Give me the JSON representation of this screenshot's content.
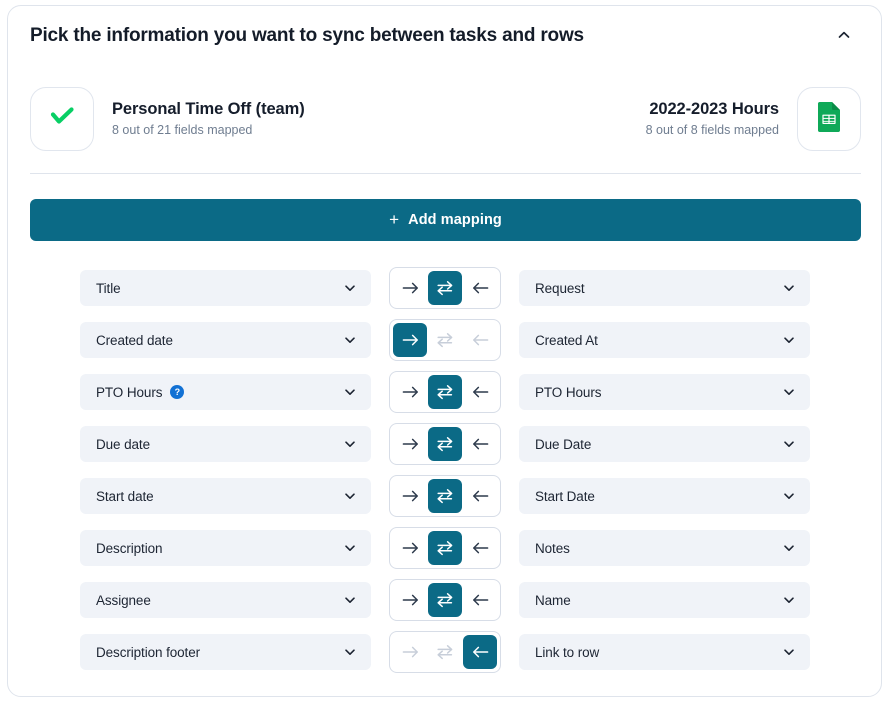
{
  "header": {
    "title": "Pick the information you want to sync between tasks and rows",
    "collapse_icon": "chevron-up-icon"
  },
  "summary": {
    "left": {
      "icon": "wrike-checkmark-icon",
      "name": "Personal Time Off (team)",
      "fields_mapped": "8 out of 21 fields mapped"
    },
    "right": {
      "icon": "google-sheets-icon",
      "name": "2022-2023 Hours",
      "fields_mapped": "8 out of 8 fields mapped"
    }
  },
  "toolbar": {
    "add_mapping_label": "Add mapping",
    "add_mapping_plus": "+"
  },
  "colors": {
    "accent_teal": "#0b6a86",
    "field_background": "#f0f3f8",
    "help_badge_blue": "#1271d4",
    "wrike_green": "#08cf65",
    "sheets_green": "#0fa958",
    "muted_text": "#6f7d90",
    "border": "#dfe4ec",
    "disabled_arrow": "#c7ced9"
  },
  "mappings": [
    {
      "left_field": "Title",
      "right_field": "Request",
      "direction": "both",
      "has_help": false,
      "right_arrow_state": "enabled",
      "both_arrow_state": "active",
      "left_arrow_state": "enabled"
    },
    {
      "left_field": "Created date",
      "right_field": "Created At",
      "direction": "right",
      "has_help": false,
      "right_arrow_state": "active",
      "both_arrow_state": "disabled",
      "left_arrow_state": "disabled"
    },
    {
      "left_field": "PTO Hours",
      "right_field": "PTO Hours",
      "direction": "both",
      "has_help": true,
      "help_label": "?",
      "right_arrow_state": "enabled",
      "both_arrow_state": "active",
      "left_arrow_state": "enabled"
    },
    {
      "left_field": "Due date",
      "right_field": "Due Date",
      "direction": "both",
      "has_help": false,
      "right_arrow_state": "enabled",
      "both_arrow_state": "active",
      "left_arrow_state": "enabled"
    },
    {
      "left_field": "Start date",
      "right_field": "Start Date",
      "direction": "both",
      "has_help": false,
      "right_arrow_state": "enabled",
      "both_arrow_state": "active",
      "left_arrow_state": "enabled"
    },
    {
      "left_field": "Description",
      "right_field": "Notes",
      "direction": "both",
      "has_help": false,
      "right_arrow_state": "enabled",
      "both_arrow_state": "active",
      "left_arrow_state": "enabled"
    },
    {
      "left_field": "Assignee",
      "right_field": "Name",
      "direction": "both",
      "has_help": false,
      "right_arrow_state": "enabled",
      "both_arrow_state": "active",
      "left_arrow_state": "enabled"
    },
    {
      "left_field": "Description footer",
      "right_field": "Link to row",
      "direction": "left",
      "has_help": false,
      "right_arrow_state": "disabled",
      "both_arrow_state": "disabled",
      "left_arrow_state": "active"
    }
  ]
}
